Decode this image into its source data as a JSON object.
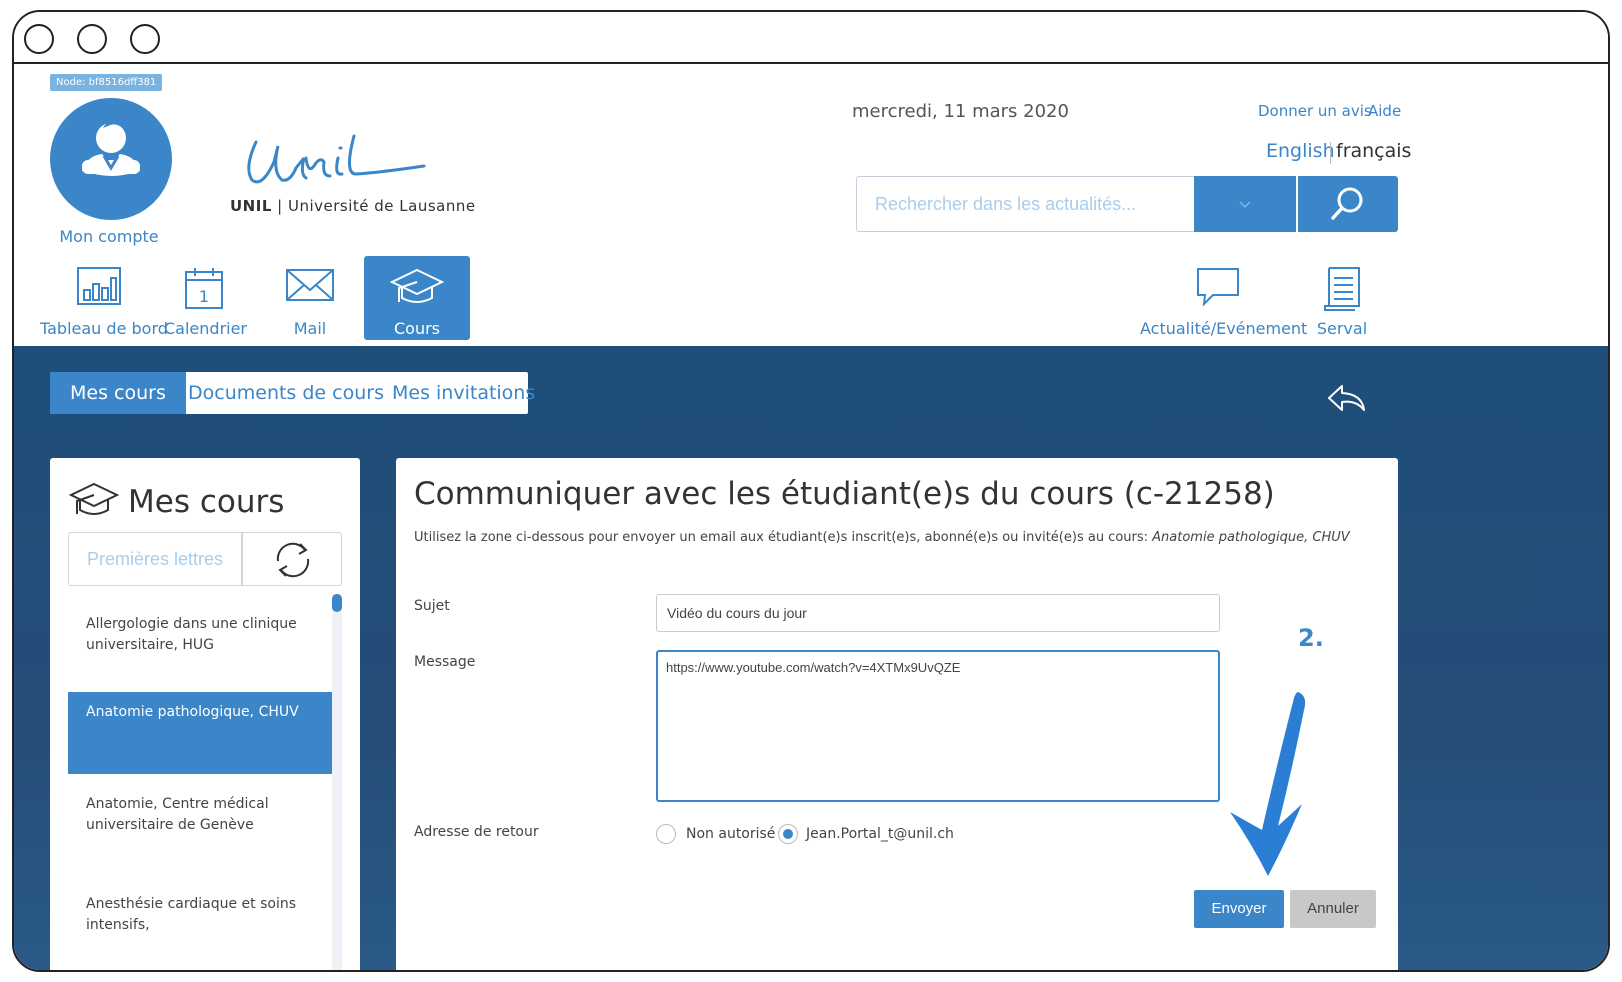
{
  "header": {
    "node_badge": "Node: bf8516dff381",
    "account_label": "Mon compte",
    "logo_script": "Unil",
    "logo_brand": "UNIL",
    "logo_separator": " | ",
    "logo_university": "Université de Lausanne",
    "date": "mercredi, 11 mars 2020",
    "feedback_link": "Donner un avis",
    "help_link": "Aide",
    "lang_english": "English",
    "lang_french": "français",
    "search_placeholder": "Rechercher dans les actualités..."
  },
  "nav": {
    "dashboard": "Tableau de bord",
    "calendar": "Calendrier",
    "calendar_day": "1",
    "mail": "Mail",
    "courses": "Cours",
    "news": "Actualité/Evénement",
    "serval": "Serval"
  },
  "tabs": {
    "my_courses": "Mes cours",
    "course_documents": "Documents de cours",
    "my_invitations": "Mes invitations"
  },
  "left_panel": {
    "title": "Mes cours",
    "filter_placeholder": "Premières lettres",
    "courses": [
      "Allergologie dans une clinique universitaire, HUG",
      "Anatomie pathologique, CHUV",
      "Anatomie, Centre médical universitaire de Genève",
      "Anesthésie cardiaque et soins intensifs,"
    ]
  },
  "main_panel": {
    "title": "Communiquer avec les étudiant(e)s du cours (c-21258)",
    "description": "Utilisez la zone ci-dessous pour envoyer un email aux étudiant(e)s inscrit(e)s, abonné(e)s ou invité(e)s au cours: ",
    "course_name": "Anatomie pathologique, CHUV",
    "subject_label": "Sujet",
    "subject_value": "Vidéo du cours du jour",
    "message_label": "Message",
    "message_value": "https://www.youtube.com/watch?v=4XTMx9UvQZE",
    "return_address_label": "Adresse de retour",
    "radio_not_allowed": "Non autorisé",
    "radio_email": "Jean.Portal_t@unil.ch",
    "step_label": "2.",
    "send_button": "Envoyer",
    "cancel_button": "Annuler"
  },
  "colors": {
    "accent": "#3a86c8",
    "dark_blue": "#1f4e7a",
    "button_grey": "#c8c8c8"
  },
  "icons": {
    "avatar": "user-avatar-icon",
    "search": "search-icon",
    "dropdown": "chevron-down-icon",
    "dashboard": "bar-chart-icon",
    "calendar": "calendar-icon",
    "mail": "envelope-icon",
    "courses": "graduation-cap-icon",
    "news": "speech-bubble-icon",
    "serval": "document-icon",
    "back": "reply-arrow-icon",
    "refresh": "refresh-icon",
    "annotation": "arrow-down-icon"
  }
}
